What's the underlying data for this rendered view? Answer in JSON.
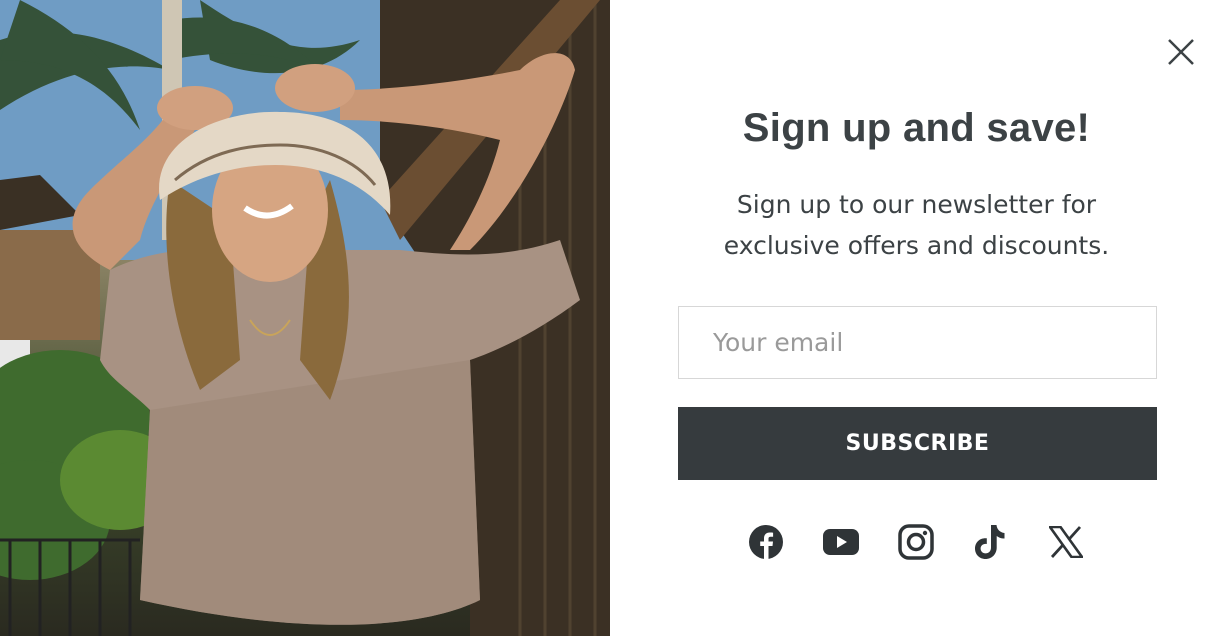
{
  "popup": {
    "title": "Sign up and save!",
    "subtitle": "Sign up to our newsletter for exclusive offers and discounts.",
    "email": {
      "placeholder": "Your email",
      "value": ""
    },
    "subscribe_label": "SUBSCRIBE",
    "close_icon": "close-icon",
    "socials": [
      "facebook-icon",
      "youtube-icon",
      "instagram-icon",
      "tiktok-icon",
      "x-icon"
    ]
  },
  "colors": {
    "text": "#3c4245",
    "button": "#363b3e",
    "button_text": "#ffffff",
    "border": "#d7d7d7",
    "placeholder": "#9a9a9a"
  }
}
